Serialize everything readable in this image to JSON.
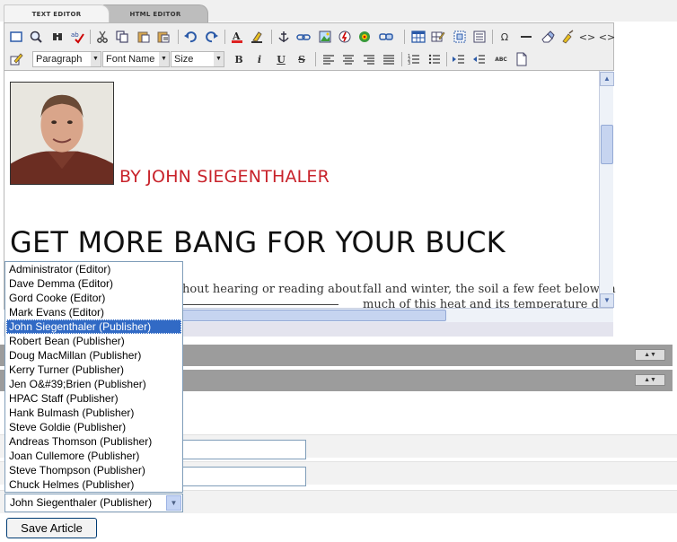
{
  "tabs": {
    "text_editor": "TEXT EDITOR",
    "html_editor": "HTML EDITOR"
  },
  "toolbar": {
    "format_select": "Paragraph",
    "font_select": "Font Name",
    "size_select": "Size",
    "bold": "B",
    "italic": "i",
    "underline": "U",
    "strike": "S",
    "omega": "Ω",
    "code_left": "<>",
    "code_right": "<>",
    "abc": "ABC"
  },
  "article": {
    "byline": "BY JOHN SIEGENTHALER",
    "headline": "GET MORE BANG FOR YOUR BUCK",
    "col1_line1": "hout hearing or reading about",
    "col2_line1": "fall and winter, the soil a few feet below th",
    "col2_line2": "much of this heat and its temperature deg"
  },
  "author_list": {
    "options": [
      "Administrator (Editor)",
      "Dave Demma (Editor)",
      "Gord Cooke (Editor)",
      "Mark Evans (Editor)",
      "John Siegenthaler (Publisher)",
      "Robert Bean (Publisher)",
      "Doug MacMillan (Publisher)",
      "Kerry Turner (Publisher)",
      "Jen O&#39;Brien (Publisher)",
      "HPAC Staff (Publisher)",
      "Hank Bulmash (Publisher)",
      "Steve Goldie (Publisher)",
      "Andreas Thomson (Publisher)",
      "Joan Cullemore (Publisher)",
      "Steve Thompson (Publisher)",
      "Chuck Helmes (Publisher)"
    ],
    "selected_index": 4,
    "selected_value": "John Siegenthaler (Publisher)"
  },
  "actions": {
    "save": "Save Article"
  },
  "colors": {
    "byline_red": "#c8232b",
    "selection_blue": "#316ac5",
    "bar_grey": "#9c9c9c"
  }
}
